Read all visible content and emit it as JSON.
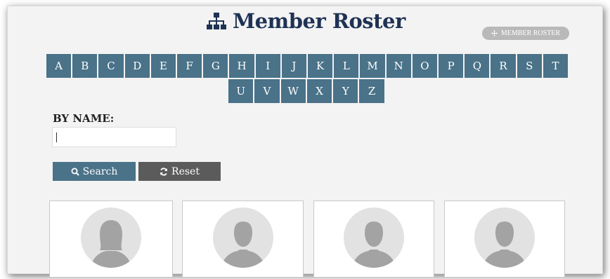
{
  "header": {
    "title": "Member Roster",
    "title_icon": "sitemap-icon"
  },
  "badge": {
    "label": "MEMBER ROSTER",
    "icon": "move-icon"
  },
  "alphabet": {
    "row1": [
      "A",
      "B",
      "C",
      "D",
      "E",
      "F",
      "G",
      "H",
      "I",
      "J",
      "K",
      "L",
      "M",
      "N",
      "O",
      "P",
      "Q",
      "R",
      "S",
      "T"
    ],
    "row2": [
      "U",
      "V",
      "W",
      "X",
      "Y",
      "Z"
    ]
  },
  "filter": {
    "label": "BY NAME:",
    "value": "",
    "placeholder": ""
  },
  "buttons": {
    "search": "Search",
    "reset": "Reset"
  },
  "members": [
    {
      "avatar": "female-avatar-icon"
    },
    {
      "avatar": "male-avatar-icon"
    },
    {
      "avatar": "male-avatar-icon"
    },
    {
      "avatar": "male-avatar-icon"
    }
  ],
  "colors": {
    "accent": "#4a7288",
    "title": "#1e3254",
    "reset": "#5b5b5b",
    "badge": "#b9b9b9",
    "background": "#f3f3f3"
  }
}
